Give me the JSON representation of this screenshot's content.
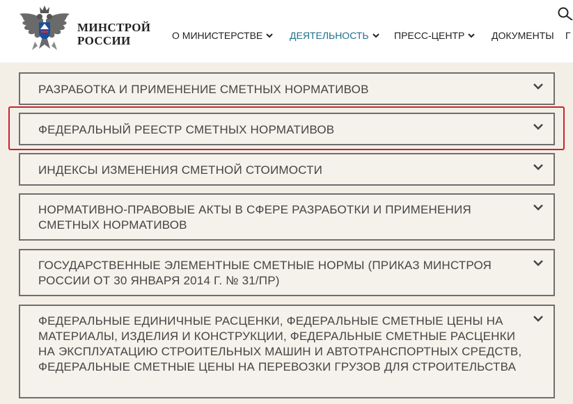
{
  "header": {
    "logo_line1": "МИНСТРОЙ",
    "logo_line2": "РОССИИ",
    "nav": [
      {
        "label": "О МИНИСТЕРСТВЕ",
        "has_dropdown": true,
        "active": false
      },
      {
        "label": "ДЕЯТЕЛЬНОСТЬ",
        "has_dropdown": true,
        "active": true
      },
      {
        "label": "ПРЕСС-ЦЕНТР",
        "has_dropdown": true,
        "active": false
      },
      {
        "label": "ДОКУМЕНТЫ",
        "has_dropdown": false,
        "active": false
      },
      {
        "label": "Г",
        "has_dropdown": false,
        "active": false
      }
    ]
  },
  "accordion": [
    {
      "title": "РАЗРАБОТКА И ПРИМЕНЕНИЕ СМЕТНЫХ НОРМАТИВОВ",
      "highlighted": false
    },
    {
      "title": "ФЕДЕРАЛЬНЫЙ РЕЕСТР СМЕТНЫХ НОРМАТИВОВ",
      "highlighted": true
    },
    {
      "title": "ИНДЕКСЫ ИЗМЕНЕНИЯ СМЕТНОЙ СТОИМОСТИ",
      "highlighted": false
    },
    {
      "title": "НОРМАТИВНО-ПРАВОВЫЕ АКТЫ В СФЕРЕ РАЗРАБОТКИ И ПРИМЕНЕНИЯ СМЕТНЫХ НОРМАТИВОВ",
      "highlighted": false
    },
    {
      "title": "ГОСУДАРСТВЕННЫЕ ЭЛЕМЕНТНЫЕ СМЕТНЫЕ НОРМЫ (ПРИКАЗ МИНСТРОЯ РОССИИ ОТ 30 ЯНВАРЯ 2014 Г. № 31/ПР)",
      "highlighted": false
    },
    {
      "title": "ФЕДЕРАЛЬНЫЕ ЕДИНИЧНЫЕ РАСЦЕНКИ, ФЕДЕРАЛЬНЫЕ СМЕТНЫЕ ЦЕНЫ НА МАТЕРИАЛЫ, ИЗДЕЛИЯ И КОНСТРУКЦИИ, ФЕДЕРАЛЬНЫЕ СМЕТНЫЕ РАСЦЕНКИ НА ЭКСПЛУАТАЦИЮ СТРОИТЕЛЬНЫХ МАШИН И АВТОТРАНСПОРТНЫХ СРЕДСТВ, ФЕДЕРАЛЬНЫЕ СМЕТНЫЕ ЦЕНЫ НА ПЕРЕВОЗКИ ГРУЗОВ ДЛЯ СТРОИТЕЛЬСТВА",
      "highlighted": false
    }
  ],
  "colors": {
    "accent": "#1f6f8b",
    "highlight": "#c8232c",
    "background": "#f3efe7",
    "border": "#6e6e6e"
  },
  "icons": {
    "emblem": "double-headed-eagle-emblem-icon",
    "chevron": "chevron-down-icon",
    "search": "search-icon"
  }
}
